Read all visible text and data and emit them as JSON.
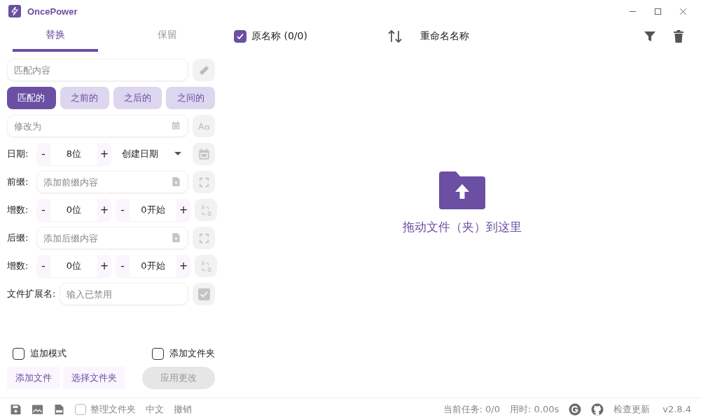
{
  "window": {
    "title": "OncePower"
  },
  "tabs": [
    {
      "label": "替换",
      "selected": true
    },
    {
      "label": "保留",
      "selected": false
    }
  ],
  "match_field": {
    "placeholder": "匹配内容"
  },
  "match_modes": [
    {
      "label": "匹配的",
      "selected": true
    },
    {
      "label": "之前的",
      "selected": false
    },
    {
      "label": "之后的",
      "selected": false
    },
    {
      "label": "之间的",
      "selected": false
    }
  ],
  "replace_field": {
    "placeholder": "修改为"
  },
  "date_row": {
    "label": "日期:",
    "stepper": {
      "minus": "-",
      "value": "8位",
      "plus": "+"
    },
    "select": "创建日期"
  },
  "prefix_row": {
    "label": "前缀:",
    "placeholder": "添加前缀内容"
  },
  "prefix_increment": {
    "label": "增数:",
    "digits": {
      "minus": "-",
      "value": "0位",
      "plus": "+"
    },
    "start": {
      "minus": "-",
      "value": "0开始",
      "plus": "+"
    }
  },
  "suffix_row": {
    "label": "后缀:",
    "placeholder": "添加后缀内容"
  },
  "suffix_increment": {
    "label": "增数:",
    "digits": {
      "minus": "-",
      "value": "0位",
      "plus": "+"
    },
    "start": {
      "minus": "-",
      "value": "0开始",
      "plus": "+"
    }
  },
  "extension_row": {
    "label": "文件扩展名:",
    "placeholder": "输入已禁用"
  },
  "options": [
    {
      "label": "追加模式",
      "checked": false
    },
    {
      "label": "添加文件夹",
      "checked": false
    }
  ],
  "actions": [
    {
      "label": "添加文件",
      "disabled": false
    },
    {
      "label": "选择文件夹",
      "disabled": false
    },
    {
      "label": "应用更改",
      "disabled": true
    }
  ],
  "header": {
    "original": {
      "label": "原名称 (0/0)",
      "checked": true
    },
    "renamed": "重命名名称"
  },
  "drop_zone": {
    "text": "拖动文件（夹）到这里"
  },
  "status_bar": {
    "organize": {
      "label": "整理文件夹",
      "checked": false
    },
    "language": "中文",
    "undo": "撤销",
    "task": "当前任务: 0/0",
    "time": "用时: 0.00s",
    "update": "检查更新",
    "version": "v2.8.4"
  }
}
